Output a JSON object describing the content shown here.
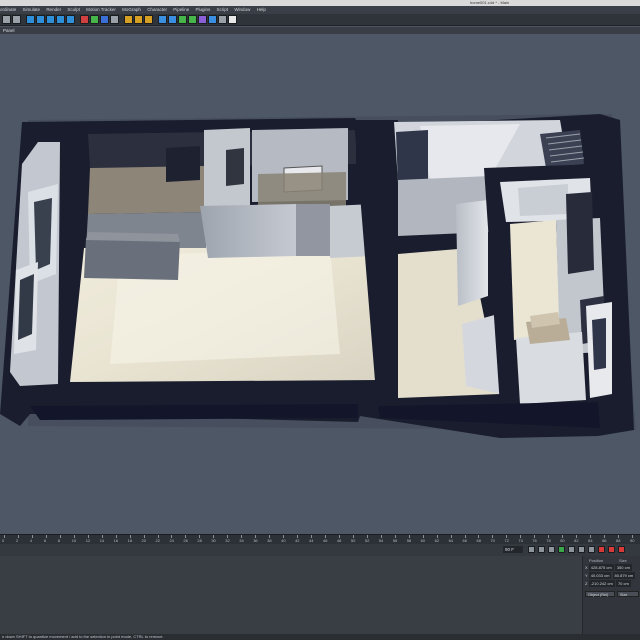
{
  "window": {
    "title": "home001.c4d * - Main"
  },
  "menu": {
    "items": [
      "ordinate",
      "Simulate",
      "Render",
      "Sculpt",
      "Motion Tracker",
      "MoGraph",
      "Character",
      "Pipeline",
      "Plugins",
      "Script",
      "Window",
      "Help"
    ]
  },
  "toolbar": {
    "icons": [
      {
        "name": "undo-icon",
        "color": "#9aa0a8"
      },
      {
        "name": "redo-icon",
        "color": "#9aa0a8"
      },
      {
        "name": "select-icon",
        "color": "#2f8fd8"
      },
      {
        "name": "move-icon",
        "color": "#2f8fd8"
      },
      {
        "name": "scale-icon",
        "color": "#2f8fd8"
      },
      {
        "name": "rotate-icon",
        "color": "#2f8fd8"
      },
      {
        "name": "recent-tool-icon",
        "color": "#2f8fd8"
      },
      {
        "name": "x-axis-icon",
        "color": "#d04040"
      },
      {
        "name": "y-axis-icon",
        "color": "#47b64a"
      },
      {
        "name": "z-axis-icon",
        "color": "#3a6fd8"
      },
      {
        "name": "coordinate-system-icon",
        "color": "#9aa0a8"
      },
      {
        "name": "render-view-icon",
        "color": "#d6a024"
      },
      {
        "name": "render-picture-viewer-icon",
        "color": "#d6a024"
      },
      {
        "name": "render-settings-icon",
        "color": "#d6a024"
      },
      {
        "name": "cube-icon",
        "color": "#3a8fe0"
      },
      {
        "name": "pen-icon",
        "color": "#3a8fe0"
      },
      {
        "name": "subdivision-icon",
        "color": "#47b64a"
      },
      {
        "name": "array-icon",
        "color": "#47b64a"
      },
      {
        "name": "deformer-icon",
        "color": "#8a5fd8"
      },
      {
        "name": "scene-floor-icon",
        "color": "#3a8fe0"
      },
      {
        "name": "camera-icon",
        "color": "#9aa0a8"
      },
      {
        "name": "light-icon",
        "color": "#e8e8e8"
      }
    ]
  },
  "panel": {
    "label": "Panel"
  },
  "timeline": {
    "ticks": [
      "0",
      "2",
      "4",
      "6",
      "8",
      "10",
      "12",
      "14",
      "16",
      "18",
      "20",
      "22",
      "24",
      "26",
      "28",
      "30",
      "32",
      "34",
      "36",
      "38",
      "40",
      "42",
      "44",
      "46",
      "48",
      "50",
      "52",
      "54",
      "56",
      "58",
      "60",
      "62",
      "64",
      "66",
      "68",
      "70",
      "72",
      "74",
      "76",
      "78",
      "80",
      "82",
      "84",
      "86",
      "88",
      "90"
    ]
  },
  "transport": {
    "frame_value": "90 F",
    "buttons": [
      {
        "name": "go-to-start-button",
        "color": "#8e949c"
      },
      {
        "name": "previous-key-button",
        "color": "#8e949c"
      },
      {
        "name": "previous-frame-button",
        "color": "#8e949c"
      },
      {
        "name": "play-button",
        "color": "#3aa84a"
      },
      {
        "name": "next-frame-button",
        "color": "#8e949c"
      },
      {
        "name": "next-key-button",
        "color": "#8e949c"
      },
      {
        "name": "go-to-end-button",
        "color": "#8e949c"
      },
      {
        "name": "record-button",
        "color": "#d83a3a"
      },
      {
        "name": "autokey-button",
        "color": "#d83a3a"
      },
      {
        "name": "keyframe-selection-button",
        "color": "#d83a3a"
      }
    ]
  },
  "attributes": {
    "position_header": "Position",
    "size_header": "Size",
    "rows": [
      {
        "axis": "X",
        "position": "428.875 cm",
        "size": "350 cm"
      },
      {
        "axis": "Y",
        "position": "40.033 cm",
        "size": "80.879 cm"
      },
      {
        "axis": "Z",
        "position": "-210.242 cm",
        "size": "70 cm"
      }
    ],
    "coord_mode": "Object (Rel)",
    "size_mode": "Size"
  },
  "status": {
    "text": "n down SHIFT to quantize movement / add to the selection in point mode, CTRL to remove."
  },
  "colors": {
    "wall_dark": "#191c2c",
    "floor": "#e6e1cf",
    "interior_wall": "#a7adb6",
    "viewport_bg": "#4e5766"
  }
}
